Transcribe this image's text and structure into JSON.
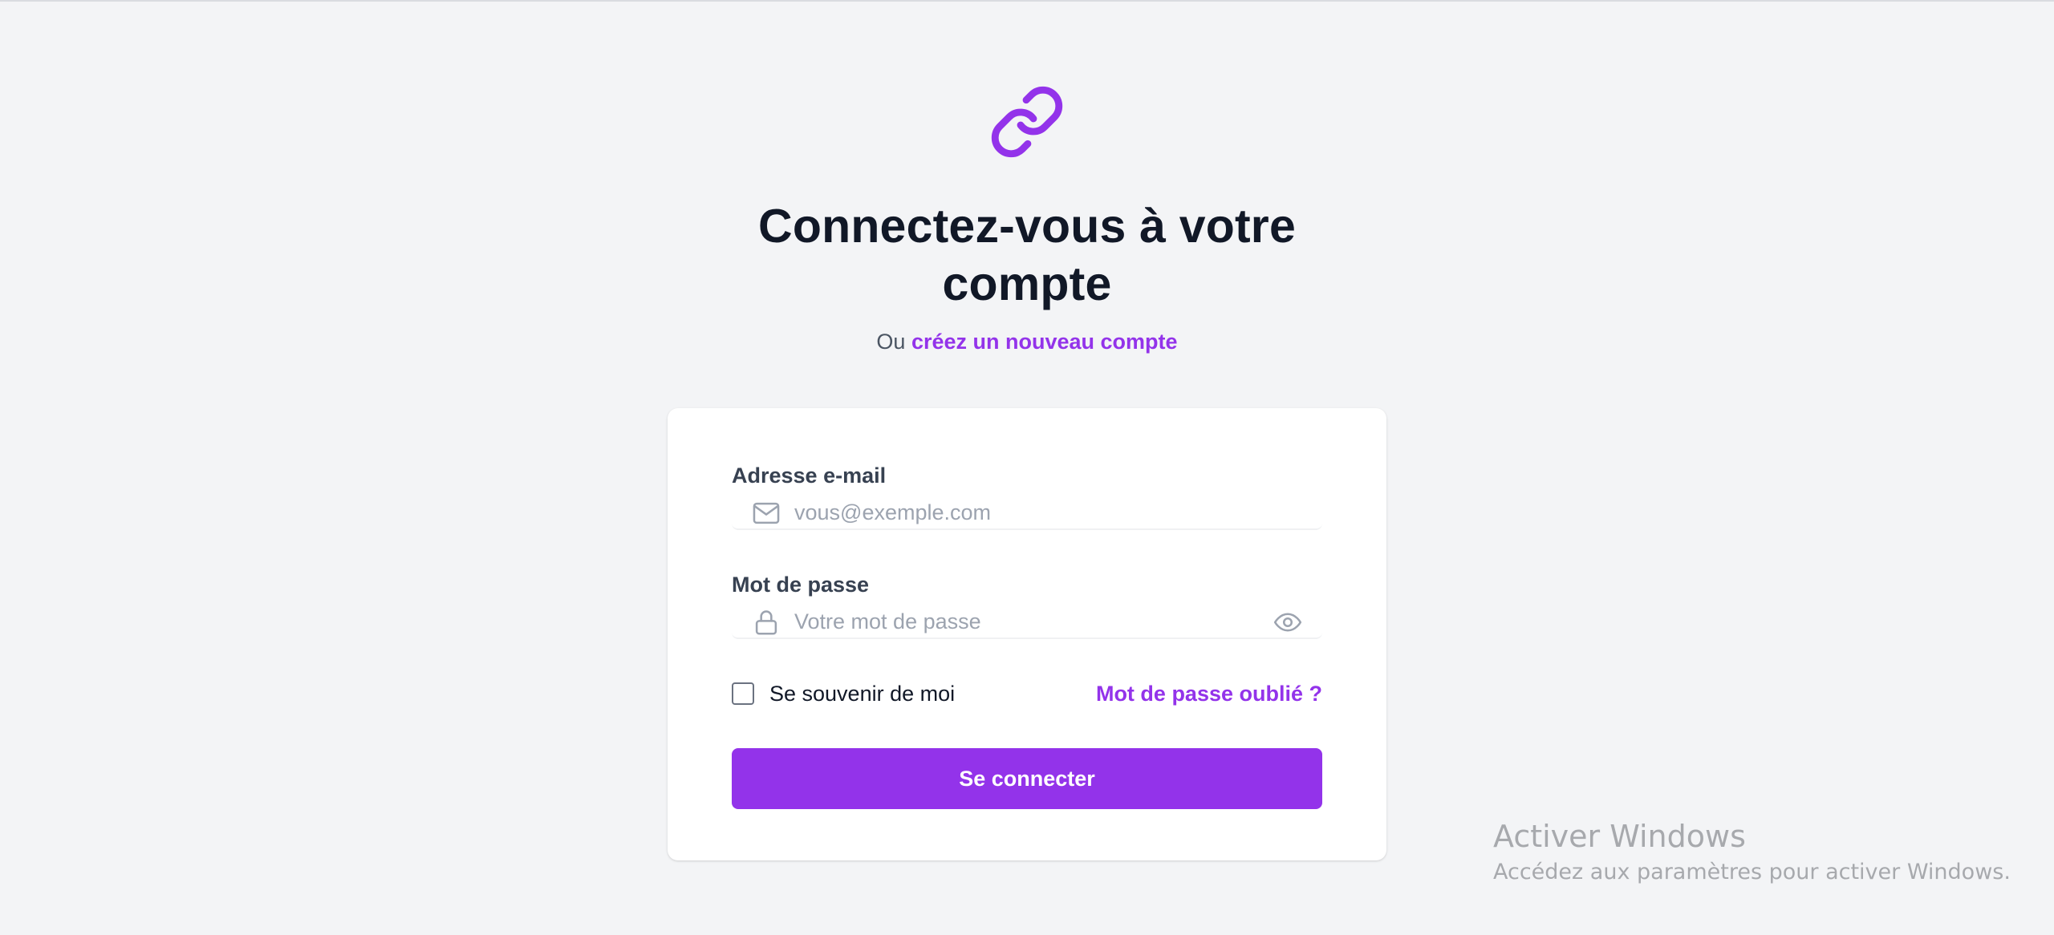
{
  "header": {
    "logo_icon": "link-icon",
    "title": "Connectez-vous à votre compte",
    "subtitle_prefix": "Ou",
    "subtitle_link": "créez un nouveau compte"
  },
  "form": {
    "email": {
      "label": "Adresse e-mail",
      "placeholder": "vous@exemple.com",
      "value": "",
      "icon": "mail-icon"
    },
    "password": {
      "label": "Mot de passe",
      "placeholder": "Votre mot de passe",
      "value": "",
      "icon": "lock-icon",
      "toggle_icon": "eye-icon"
    },
    "remember_label": "Se souvenir de moi",
    "remember_checked": false,
    "forgot_label": "Mot de passe oublié ?",
    "submit_label": "Se connecter"
  },
  "watermark": {
    "title": "Activer Windows",
    "subtitle": "Accédez aux paramètres pour activer Windows."
  },
  "colors": {
    "accent": "#9333ea",
    "background": "#f3f4f6",
    "card": "#ffffff",
    "heading": "#111827",
    "placeholder": "#9ca3af"
  }
}
